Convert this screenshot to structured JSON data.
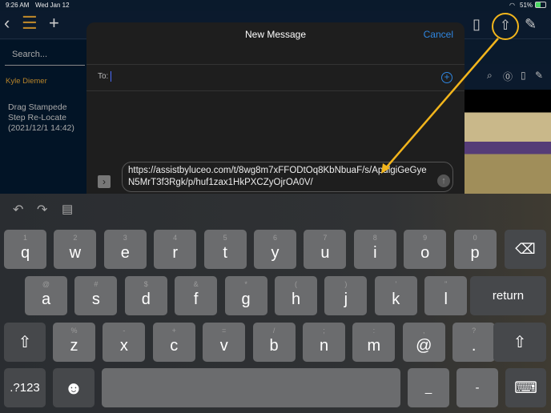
{
  "status": {
    "time": "9:26 AM",
    "date": "Wed Jan 12",
    "battery": "51%"
  },
  "sidebar": {
    "search_placeholder": "Search...",
    "user": "Kyle Diemer",
    "item": "Drag Stampede Step Re-Locate (2021/12/1 14:42)"
  },
  "compose": {
    "title": "New Message",
    "cancel": "Cancel",
    "to_label": "To:",
    "body": "https://assistbyluceo.com/t/8wg8m7xFFODtOq8KbNbuaF/s/ApdlgiGeGyeN5MrT3f3Rgk/p/huf1zax1HkPXCZyOjrOA0V/"
  },
  "colors": {
    "accent": "#2f86e0",
    "highlight": "#f2b51c",
    "user": "#b9852a"
  },
  "keyboard": {
    "row1": [
      [
        "1",
        "q"
      ],
      [
        "2",
        "w"
      ],
      [
        "3",
        "e"
      ],
      [
        "4",
        "r"
      ],
      [
        "5",
        "t"
      ],
      [
        "6",
        "y"
      ],
      [
        "7",
        "u"
      ],
      [
        "8",
        "i"
      ],
      [
        "9",
        "o"
      ],
      [
        "0",
        "p"
      ]
    ],
    "row2": [
      [
        "@",
        "a"
      ],
      [
        "#",
        "s"
      ],
      [
        "$",
        "d"
      ],
      [
        "&",
        "f"
      ],
      [
        "*",
        "g"
      ],
      [
        "(",
        "h"
      ],
      [
        ")",
        "j"
      ],
      [
        "'",
        "k"
      ],
      [
        "\"",
        "l"
      ]
    ],
    "row3": [
      [
        "%",
        "z"
      ],
      [
        "-",
        "x"
      ],
      [
        "+",
        "c"
      ],
      [
        "=",
        "v"
      ],
      [
        "/",
        "b"
      ],
      [
        ";",
        "n"
      ],
      [
        ":",
        "m"
      ],
      [
        ",",
        "@"
      ],
      [
        "?",
        "."
      ]
    ],
    "return": "return",
    "numbers": ".?123",
    "underscore": "_",
    "dash": "-",
    "backspace_icon": "⌫",
    "shift_icon": "⇧",
    "emoji_icon": "☻",
    "hide_keyboard_icon": "⌨"
  }
}
